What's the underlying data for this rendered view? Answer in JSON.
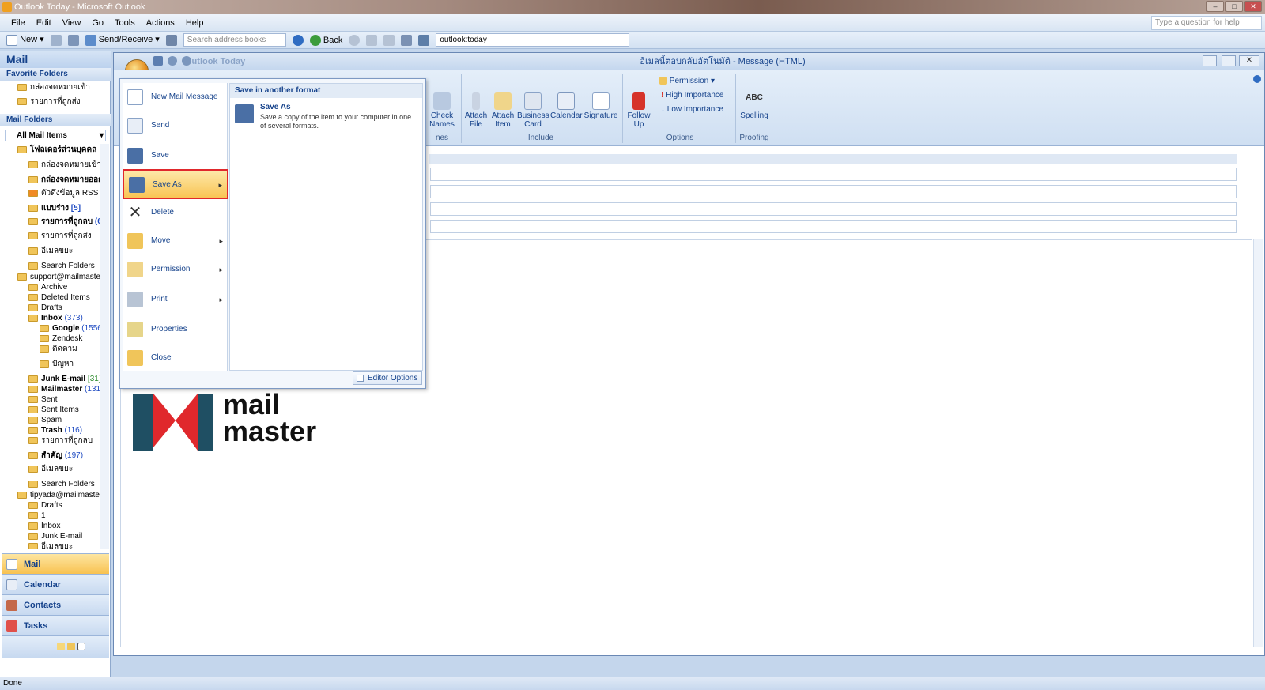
{
  "window": {
    "title": "Outlook Today - Microsoft Outlook"
  },
  "menubar": {
    "items": [
      "File",
      "Edit",
      "View",
      "Go",
      "Tools",
      "Actions",
      "Help"
    ],
    "help_placeholder": "Type a question for help"
  },
  "toolbar": {
    "new_label": "New",
    "send_receive_label": "Send/Receive",
    "search_placeholder": "Search address books",
    "back_label": "Back",
    "address_value": "outlook:today"
  },
  "nav": {
    "title": "Mail",
    "favorite_header": "Favorite Folders",
    "favorites": [
      "กล่องจดหมายเข้า",
      "รายการที่ถูกส่ง"
    ],
    "mail_folders_header": "Mail Folders",
    "all_items": "All Mail Items",
    "personal": "โฟลเดอร์ส่วนบุคคล",
    "personal_children": [
      {
        "label": "กล่องจดหมายเข้า",
        "count": ""
      },
      {
        "label": "กล่องจดหมายออก",
        "count": ""
      },
      {
        "label": "ตัวดึงข้อมูล RSS",
        "count": ""
      },
      {
        "label": "แบบร่าง",
        "count": "[5]"
      },
      {
        "label": "รายการที่ถูกลบ",
        "count": "(6"
      },
      {
        "label": "รายการที่ถูกส่ง",
        "count": ""
      },
      {
        "label": "อีเมลขยะ",
        "count": ""
      }
    ],
    "search_folders": "Search Folders",
    "account1": "support@mailmaster",
    "archive": "Archive",
    "deleted_items": "Deleted Items",
    "drafts": "Drafts",
    "inbox": "Inbox",
    "inbox_count": "(373)",
    "google": "Google",
    "google_count": "(1556",
    "zendesk": "Zendesk",
    "tidtam": "ติดตาม",
    "panha": "ปัญหา",
    "junk": "Junk E-mail",
    "junk_count": "[31]",
    "mailmaster": "Mailmaster",
    "mailmaster_count": "(1319",
    "sent": "Sent",
    "sent_items": "Sent Items",
    "spam": "Spam",
    "trash": "Trash",
    "trash_count": "(116)",
    "deleted_th": "รายการที่ถูกลบ",
    "important": "สำคัญ",
    "important_count": "(197)",
    "junk_th": "อีเมลขยะ",
    "search_folders2": "Search Folders",
    "account2": "tipyada@mailmaster",
    "drafts2": "Drafts",
    "one": "1",
    "inbox2": "Inbox",
    "junk2": "Junk E-mail",
    "junk2_th": "อีเมลขยะ",
    "buttons": [
      "Mail",
      "Calendar",
      "Contacts",
      "Tasks"
    ]
  },
  "message": {
    "title": "อีเมลนี้ตอบกลับอัตโนมัติ - Message (HTML)",
    "qat_title": "Outlook Today"
  },
  "ribbon": {
    "check_names": "Check\nNames",
    "attach_file": "Attach\nFile",
    "attach_item": "Attach\nItem",
    "business_card": "Business\nCard",
    "calendar": "Calendar",
    "signature": "Signature",
    "follow_up": "Follow\nUp",
    "permission": "Permission",
    "high_importance": "High Importance",
    "low_importance": "Low Importance",
    "spelling": "Spelling",
    "spelling_icon_text": "ABC",
    "group_names_frag": "nes",
    "group_include": "Include",
    "group_options": "Options",
    "group_proofing": "Proofing"
  },
  "office_menu": {
    "items": [
      {
        "label": "New Mail Message",
        "icon": "new-mail-icon"
      },
      {
        "label": "Send",
        "icon": "send-icon"
      },
      {
        "label": "Save",
        "icon": "save-icon"
      },
      {
        "label": "Save As",
        "icon": "save-as-icon"
      },
      {
        "label": "Delete",
        "icon": "delete-icon"
      },
      {
        "label": "Move",
        "icon": "move-icon"
      },
      {
        "label": "Permission",
        "icon": "permission-icon"
      },
      {
        "label": "Print",
        "icon": "print-icon"
      },
      {
        "label": "Properties",
        "icon": "properties-icon"
      },
      {
        "label": "Close",
        "icon": "close-folder-icon"
      }
    ],
    "submenu_header": "Save in another format",
    "submenu_title": "Save As",
    "submenu_desc": "Save a copy of the item to your computer in one of several formats.",
    "editor_options": "Editor Options"
  },
  "logo": {
    "line1": "mail",
    "line2": "master",
    "color_dark": "#1f4f63",
    "color_red": "#e0282c"
  },
  "status": {
    "text": "Done"
  }
}
